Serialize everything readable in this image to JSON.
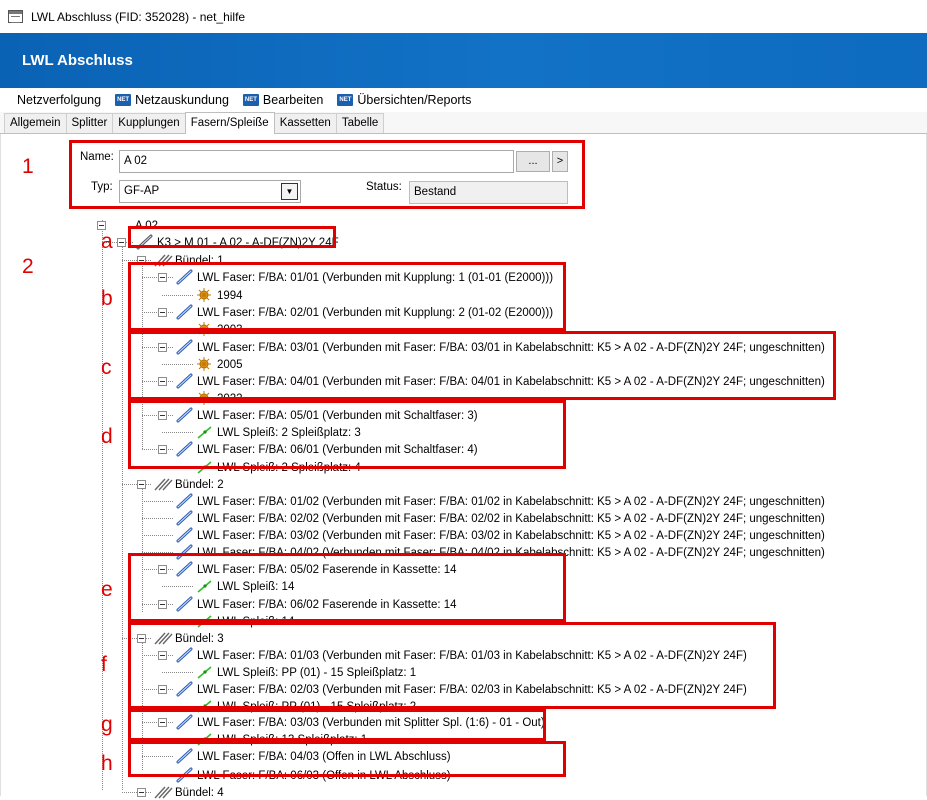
{
  "window": {
    "title": "LWL Abschluss (FID: 352028) - net_hilfe"
  },
  "header": {
    "title": "LWL Abschluss"
  },
  "menu": {
    "items": [
      {
        "label": "Netzverfolgung",
        "icon": ""
      },
      {
        "label": "Netzauskundung",
        "icon": "net-icon"
      },
      {
        "label": "Bearbeiten",
        "icon": "net-icon"
      },
      {
        "label": "Übersichten/Reports",
        "icon": "net-icon"
      }
    ],
    "badge_text": "NET"
  },
  "tabs": [
    "Allgemein",
    "Splitter",
    "Kupplungen",
    "Fasern/Spleiße",
    "Kassetten",
    "Tabelle"
  ],
  "active_tab": "Fasern/Spleiße",
  "form": {
    "name_label": "Name:",
    "name_value": "A 02",
    "browse_label": "...",
    "next_label": ">",
    "type_label": "Typ:",
    "type_value": "GF-AP",
    "status_label": "Status:",
    "status_value": "Bestand"
  },
  "annotations": {
    "n1": "1",
    "n2": "2",
    "a": "a",
    "b": "b",
    "c": "c",
    "d": "d",
    "e": "e",
    "f": "f",
    "g": "g",
    "h": "h"
  },
  "tree": {
    "root": "A 02",
    "cable": "K3 > M 01 - A 02 - A-DF(ZN)2Y 24F",
    "bundle1": "Bündel: 1",
    "b1_f1": "LWL Faser: F/BA: 01/01 (Verbunden mit Kupplung: 1 (01-01 (E2000)))",
    "b1_f1_c": "1994",
    "b1_f2": "LWL Faser: F/BA: 02/01 (Verbunden mit Kupplung: 2 (01-02 (E2000)))",
    "b1_f2_c": "2003",
    "b1_f3": "LWL Faser: F/BA: 03/01 (Verbunden mit Faser: F/BA: 03/01 in Kabelabschnitt: K5 > A 02 - A-DF(ZN)2Y 24F; ungeschnitten)",
    "b1_f3_c": "2005",
    "b1_f4": "LWL Faser: F/BA: 04/01 (Verbunden mit Faser: F/BA: 04/01 in Kabelabschnitt: K5 > A 02 - A-DF(ZN)2Y 24F; ungeschnitten)",
    "b1_f4_c": "2022",
    "b1_f5": "LWL Faser: F/BA: 05/01 (Verbunden mit Schaltfaser: 3)",
    "b1_f5_c": "LWL Spleiß: 2 Spleißplatz: 3",
    "b1_f6": "LWL Faser: F/BA: 06/01 (Verbunden mit Schaltfaser: 4)",
    "b1_f6_c": "LWL Spleiß: 2 Spleißplatz: 4",
    "bundle2": "Bündel: 2",
    "b2_f1": "LWL Faser: F/BA: 01/02 (Verbunden mit Faser: F/BA: 01/02 in Kabelabschnitt: K5 > A 02 - A-DF(ZN)2Y 24F; ungeschnitten)",
    "b2_f2": "LWL Faser: F/BA: 02/02 (Verbunden mit Faser: F/BA: 02/02 in Kabelabschnitt: K5 > A 02 - A-DF(ZN)2Y 24F; ungeschnitten)",
    "b2_f3": "LWL Faser: F/BA: 03/02 (Verbunden mit Faser: F/BA: 03/02 in Kabelabschnitt: K5 > A 02 - A-DF(ZN)2Y 24F; ungeschnitten)",
    "b2_f4": "LWL Faser: F/BA: 04/02 (Verbunden mit Faser: F/BA: 04/02 in Kabelabschnitt: K5 > A 02 - A-DF(ZN)2Y 24F; ungeschnitten)",
    "b2_f5": "LWL Faser: F/BA: 05/02 Faserende in Kassette: 14",
    "b2_f5_c": "LWL Spleiß: 14",
    "b2_f6": "LWL Faser: F/BA: 06/02 Faserende in Kassette: 14",
    "b2_f6_c": "LWL Spleiß: 14",
    "bundle3": "Bündel: 3",
    "b3_f1": "LWL Faser: F/BA: 01/03 (Verbunden mit Faser: F/BA: 01/03 in Kabelabschnitt: K5 > A 02 - A-DF(ZN)2Y 24F)",
    "b3_f1_c": "LWL Spleiß: PP (01) - 15 Spleißplatz: 1",
    "b3_f2": "LWL Faser: F/BA: 02/03 (Verbunden mit Faser: F/BA: 02/03 in Kabelabschnitt: K5 > A 02 - A-DF(ZN)2Y 24F)",
    "b3_f2_c": "LWL Spleiß: PP (01) - 15 Spleißplatz: 2",
    "b3_f3": "LWL Faser: F/BA: 03/03 (Verbunden mit Splitter Spl. (1:6) - 01 - Out)",
    "b3_f3_c": "LWL Spleiß: 13 Spleißplatz: 1",
    "b3_f4": "LWL Faser: F/BA: 04/03 (Offen in LWL Abschluss)",
    "b3_f5": "LWL Faser: F/BA: 06/03 (Offen in LWL Abschluss)",
    "bundle4": "Bündel: 4"
  },
  "colors": {
    "header_blue": "#0e6bbf",
    "annotation_red": "#e00000",
    "splice_green": "#2bbf2b",
    "fiber_blue": "#2a5bb5",
    "coupling_orange": "#f0a020"
  }
}
